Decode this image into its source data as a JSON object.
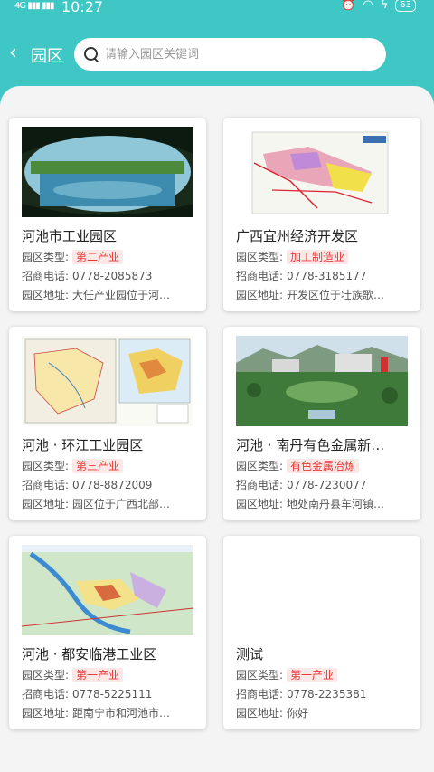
{
  "status_bar": {
    "signal": "4G ▮▮▮ ▮▮▮",
    "time": "10:27",
    "battery": "63"
  },
  "nav": {
    "back_icon": "chevron-left-icon",
    "title": "园区"
  },
  "search": {
    "placeholder": "请输入园区关键词"
  },
  "labels": {
    "type": "园区类型:",
    "phone": "招商电话:",
    "addr": "园区地址:"
  },
  "colors": {
    "header": "#3ec7c4",
    "badge_text": "#e53935",
    "badge_bg": "#fde8e8"
  },
  "parks": [
    {
      "name": "河池市工业园区",
      "type": "第二产业",
      "phone": "0778-2085873",
      "address": "大任产业园位于河…"
    },
    {
      "name": "广西宜州经济开发区",
      "type": "加工制造业",
      "phone": "0778-3185177",
      "address": "开发区位于壮族歌…"
    },
    {
      "name": "河池 · 环江工业园区",
      "type": "第三产业",
      "phone": "0778-8872009",
      "address": "园区位于广西北部…"
    },
    {
      "name": "河池 · 南丹有色金属新…",
      "type": "有色金属冶炼",
      "phone": "0778-7230077",
      "address": "地处南丹县车河镇…"
    },
    {
      "name": "河池 · 都安临港工业区",
      "type": "第一产业",
      "phone": "0778-5225111",
      "address": "距南宁市和河池市…"
    },
    {
      "name": "测试",
      "type": "第一产业",
      "phone": "0778-2235381",
      "address": "你好"
    }
  ]
}
